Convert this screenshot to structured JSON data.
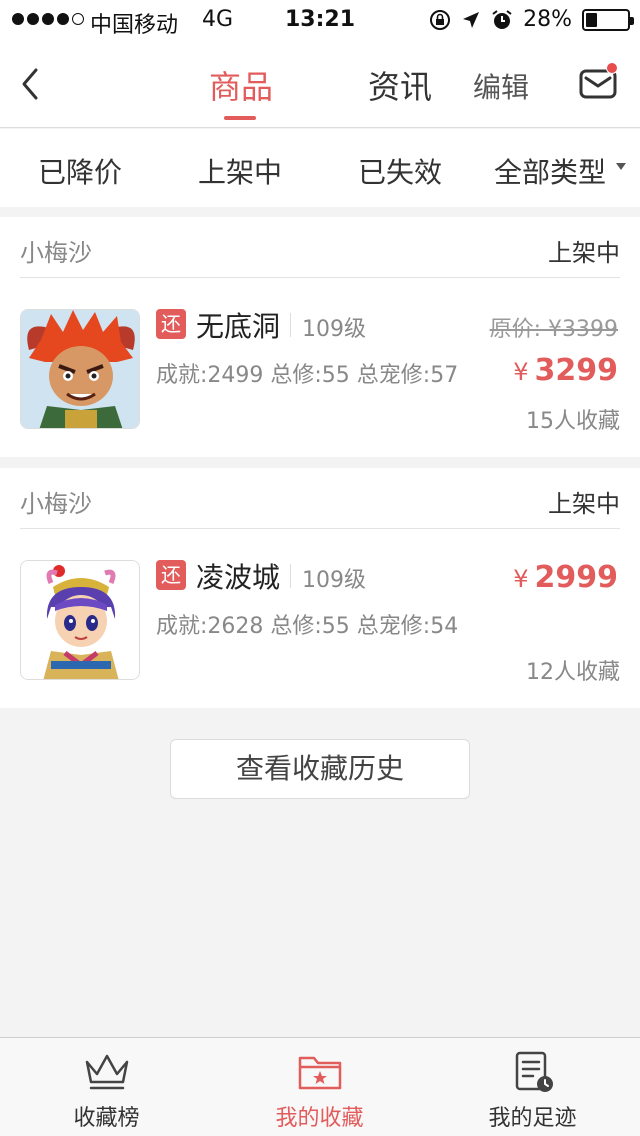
{
  "status_bar": {
    "carrier": "中国移动",
    "network": "4G",
    "time": "13:21",
    "battery": "28%",
    "battery_level": 0.28
  },
  "nav": {
    "tabs": [
      {
        "label": "商品",
        "active": true
      },
      {
        "label": "资讯",
        "active": false
      }
    ],
    "edit_label": "编辑",
    "back_icon": "chevron-left-icon",
    "mail_icon": "mail-icon",
    "mail_has_notification": true
  },
  "filters": [
    "已降价",
    "上架中",
    "已失效",
    "全部类型"
  ],
  "items": [
    {
      "seller": "小梅沙",
      "status": "上架中",
      "tag": "还",
      "server": "无底洞",
      "level": "109级",
      "stats": "成就:2499 总修:55 总宠修:57",
      "original_price": "原价: ¥3399",
      "price_symbol": "¥",
      "price": "3299",
      "favorites": "15人收藏"
    },
    {
      "seller": "小梅沙",
      "status": "上架中",
      "tag": "还",
      "server": "凌波城",
      "level": "109级",
      "stats": "成就:2628 总修:55 总宠修:54",
      "price_symbol": "¥",
      "price": "2999",
      "favorites": "12人收藏"
    }
  ],
  "history_button": "查看收藏历史",
  "tabbar": [
    {
      "label": "收藏榜",
      "icon": "crown-icon",
      "active": false
    },
    {
      "label": "我的收藏",
      "icon": "folder-star-icon",
      "active": true
    },
    {
      "label": "我的足迹",
      "icon": "history-list-icon",
      "active": false
    }
  ],
  "colors": {
    "accent": "#e25c5c",
    "background": "#f3f3f3"
  }
}
